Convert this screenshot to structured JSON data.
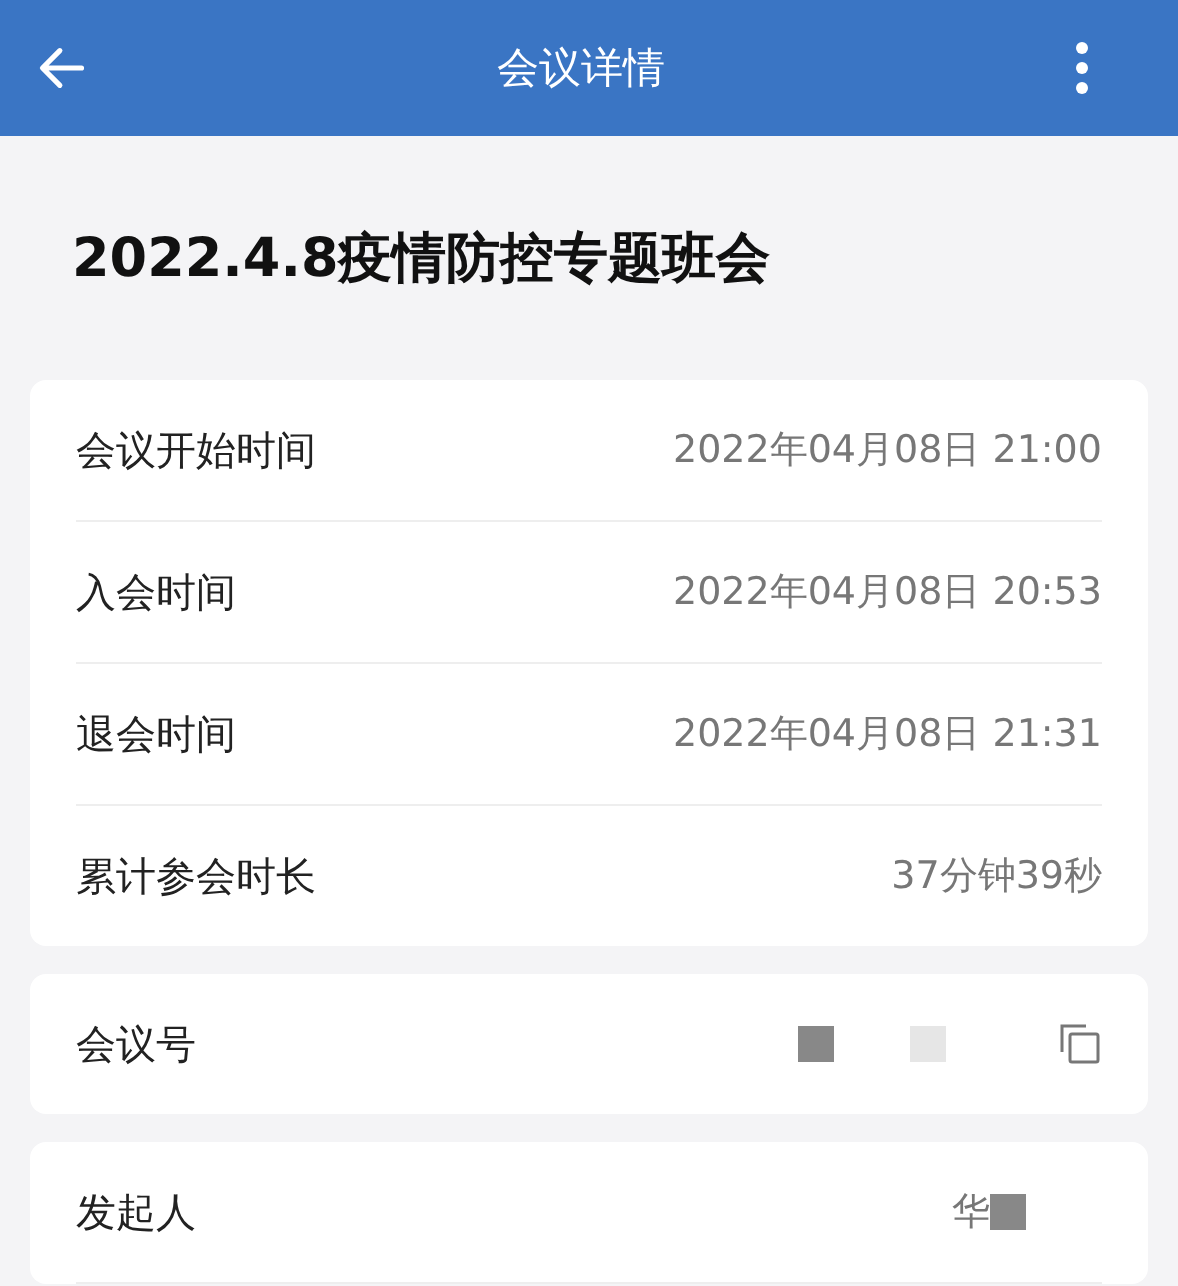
{
  "header": {
    "title": "会议详情"
  },
  "meeting_title": "2022.4.8疫情防控专题班会",
  "time_rows": [
    {
      "label": "会议开始时间",
      "value": "2022年04月08日 21:00"
    },
    {
      "label": "入会时间",
      "value": "2022年04月08日 20:53"
    },
    {
      "label": "退会时间",
      "value": "2022年04月08日 21:31"
    },
    {
      "label": "累计参会时长",
      "value": "37分钟39秒"
    }
  ],
  "meeting_number": {
    "label": "会议号"
  },
  "initiator": {
    "label": "发起人",
    "value": "华"
  }
}
